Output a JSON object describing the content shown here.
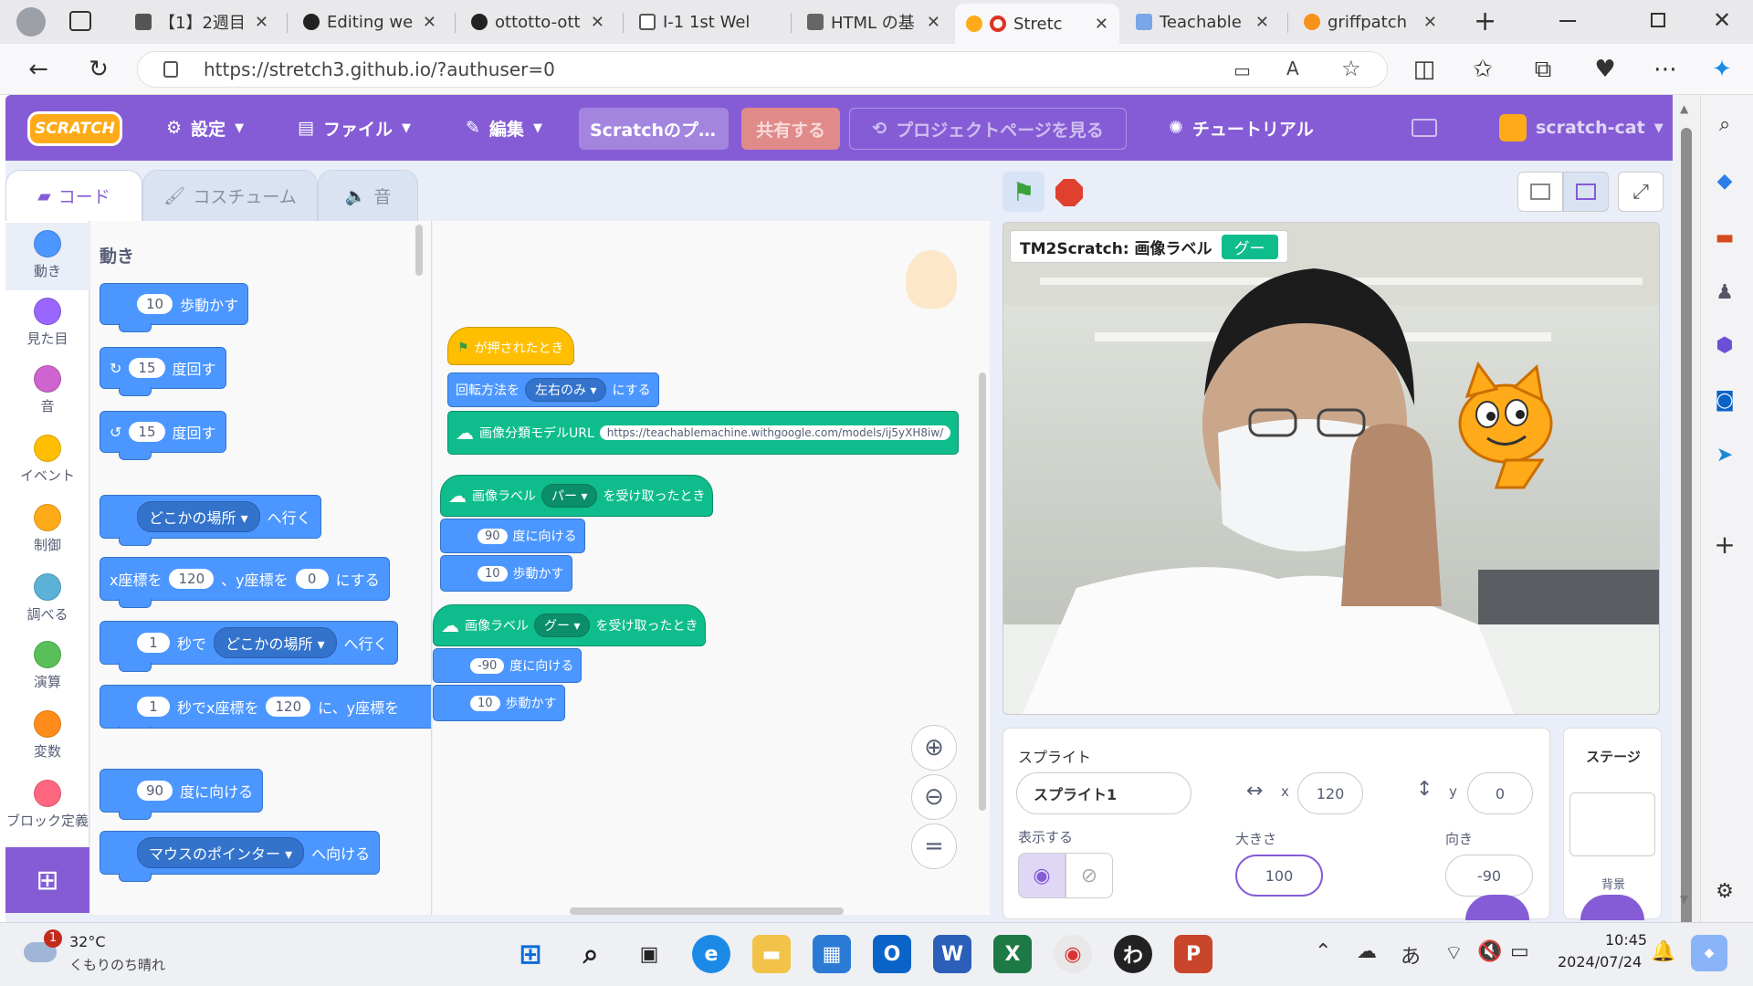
{
  "browser": {
    "tabs": [
      {
        "title": "【1】2週目",
        "active": false
      },
      {
        "title": "Editing we",
        "active": false
      },
      {
        "title": "ottotto-ott",
        "active": false
      },
      {
        "title": "I-1 1st Wel",
        "active": false
      },
      {
        "title": "HTML の基",
        "active": false
      },
      {
        "title": "Stretc",
        "active": true
      },
      {
        "title": "Teachable",
        "active": false
      },
      {
        "title": "griffpatch",
        "active": false
      }
    ],
    "new_tab": "+",
    "url": "https://stretch3.github.io/?authuser=0"
  },
  "menubar": {
    "logo": "SCRATCH",
    "settings": "設定",
    "file": "ファイル",
    "edit": "編集",
    "project_title": "Scratchのプ…",
    "share": "共有する",
    "see_project": "プロジェクトページを見る",
    "tutorial": "チュートリアル",
    "username": "scratch-cat"
  },
  "editor_tabs": {
    "code": "コード",
    "costumes": "コスチューム",
    "sounds": "音"
  },
  "categories": [
    {
      "label": "動き",
      "color": "#4c97ff"
    },
    {
      "label": "見た目",
      "color": "#9966ff"
    },
    {
      "label": "音",
      "color": "#cf63cf"
    },
    {
      "label": "イベント",
      "color": "#ffbf00"
    },
    {
      "label": "制御",
      "color": "#ffab19"
    },
    {
      "label": "調べる",
      "color": "#5cb1d6"
    },
    {
      "label": "演算",
      "color": "#59c059"
    },
    {
      "label": "変数",
      "color": "#ff8c1a"
    },
    {
      "label": "ブロック定義",
      "color": "#ff6680"
    }
  ],
  "palette": {
    "heading": "動き",
    "move": {
      "value": "10",
      "text": "歩動かす"
    },
    "turn_right": {
      "value": "15",
      "text": "度回す"
    },
    "turn_left": {
      "value": "15",
      "text": "度回す"
    },
    "goto": {
      "menu": "どこかの場所",
      "text": "へ行く"
    },
    "gotoxy": {
      "t1": "x座標を",
      "x": "120",
      "t2": "、y座標を",
      "y": "0",
      "t3": "にする"
    },
    "glide": {
      "secs": "1",
      "t1": "秒で",
      "menu": "どこかの場所",
      "t2": "へ行く"
    },
    "glidexy": {
      "secs": "1",
      "t1": "秒でx座標を",
      "x": "120",
      "t2": "に、y座標を"
    },
    "point": {
      "value": "90",
      "text": "度に向ける"
    },
    "point_towards": {
      "menu": "マウスのポインター",
      "text": "へ向ける"
    }
  },
  "script": {
    "hat": "が押されたとき",
    "rotation": {
      "t1": "回転方法を",
      "menu": "左右のみ",
      "t2": "にする"
    },
    "model": {
      "text": "画像分類モデルURL",
      "url": "https://teachablemachine.withgoogle.com/models/ij5yXH8iw/"
    },
    "when1": {
      "t1": "画像ラベル",
      "menu": "パー",
      "t2": "を受け取ったとき"
    },
    "point1": {
      "value": "90",
      "text": "度に向ける"
    },
    "move1": {
      "value": "10",
      "text": "歩動かす"
    },
    "when2": {
      "t1": "画像ラベル",
      "menu": "グー",
      "t2": "を受け取ったとき"
    },
    "point2": {
      "value": "-90",
      "text": "度に向ける"
    },
    "move2": {
      "value": "10",
      "text": "歩動かす"
    }
  },
  "stage": {
    "monitor_label": "TM2Scratch: 画像ラベル",
    "monitor_value": "グー"
  },
  "sprite_info": {
    "title": "スプライト",
    "name": "スプライト1",
    "x_label": "x",
    "x": "120",
    "y_label": "y",
    "y": "0",
    "show_label": "表示する",
    "size_label": "大きさ",
    "size": "100",
    "direction_label": "向き",
    "direction": "-90"
  },
  "stage_panel": {
    "title": "ステージ",
    "backdrop_label": "背景"
  },
  "taskbar": {
    "notification_count": "1",
    "weather_temp": "32°C",
    "weather_desc": "くもりのち晴れ",
    "ime": "あ",
    "time": "10:45",
    "date": "2024/07/24"
  }
}
